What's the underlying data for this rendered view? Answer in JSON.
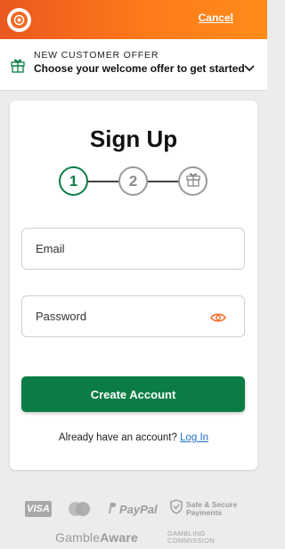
{
  "header": {
    "cancel_label": "Cancel",
    "logo_icon": "lion-logo-icon",
    "brand_color": "#f26722"
  },
  "offer": {
    "title": "NEW CUSTOMER OFFER",
    "subtitle": "Choose your welcome offer to get started",
    "gift_icon": "gift-icon",
    "chevron_icon": "chevron-down-icon",
    "accent_color": "#0b7d44"
  },
  "signup": {
    "title": "Sign Up",
    "steps": [
      {
        "label": "1",
        "state": "active"
      },
      {
        "label": "2",
        "state": "inactive"
      },
      {
        "label": "",
        "icon": "gift-icon",
        "state": "inactive"
      }
    ],
    "email_placeholder": "Email",
    "password_placeholder": "Password",
    "eye_icon": "eye-icon",
    "create_button": "Create Account",
    "login_prompt": "Already have an account?",
    "login_link": "Log In"
  },
  "footer": {
    "visa": "VISA",
    "paypal": "PayPal",
    "secure_line1": "Safe & Secure",
    "secure_line2": "Payments",
    "gamble_aware_1": "Gamble",
    "gamble_aware_2": "Aware",
    "commission_line1": "GAMBLING",
    "commission_line2": "COMMISSION"
  }
}
